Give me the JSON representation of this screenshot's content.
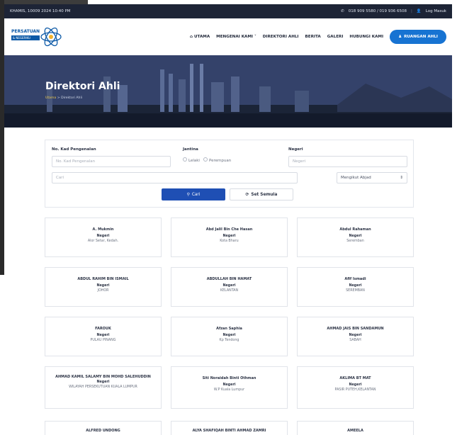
{
  "topbar": {
    "datetime": "KHAMIS, 10009 2024 10:40 PM",
    "phone": "018 909 5580 / 019 936 6508",
    "login": "Log Masuk"
  },
  "header": {
    "logo_line1": "PERSATUAN",
    "logo_line2": "& NEGERIKU",
    "nav": [
      "UTAMA",
      "MENGENAI KAMI",
      "DIREKTORI AHLI",
      "BERITA",
      "GALERI",
      "HUBUNGI KAMI"
    ],
    "cta": "RUANGAN AHLI"
  },
  "hero": {
    "title": "Direktori Ahli",
    "crumb_home": "Utama",
    "crumb_sep": ">",
    "crumb_current": "Direktori Ahli"
  },
  "filter": {
    "ic_label": "No. Kad Pengenalan",
    "ic_placeholder": "No. Kad Pengenalan",
    "gender_label": "Jantina",
    "gender_options": [
      "Lelaki",
      "Perempuan"
    ],
    "state_label": "Negeri",
    "state_placeholder": "Negeri",
    "search_placeholder": "Cari",
    "sort_value": "Mengikut Abjad",
    "search_button": "Cari",
    "reset_button": "Set Semula"
  },
  "members": [
    {
      "name": "A. Mukmin",
      "label": "Negeri",
      "state": "Alor Setar, Kedah."
    },
    {
      "name": "Abd Jalil Bin Che Hasan",
      "label": "Negeri",
      "state": "Kota Bharu"
    },
    {
      "name": "Abdul Rahaman",
      "label": "Negeri",
      "state": "Seremban"
    },
    {
      "name": "ABDUL RAHIM BIN ISMAIL",
      "label": "Negeri",
      "state": "JOHOR"
    },
    {
      "name": "ABDULLAH BIN HAMAT",
      "label": "Negeri",
      "state": "KELANTAN"
    },
    {
      "name": "Afif Ismadi",
      "label": "Negeri",
      "state": "SEREMBAN"
    },
    {
      "name": "FAROUK",
      "label": "Negeri",
      "state": "PULAU PINANG"
    },
    {
      "name": "Afzan Saphia",
      "label": "Negeri",
      "state": "Kp Tendong"
    },
    {
      "name": "AHMAD JAIS BIN SANDAMUN",
      "label": "Negeri",
      "state": "SABAH"
    },
    {
      "name": "AHMAD KAMIL SALAMY BIN MOHD SALEHUDDIN",
      "label": "Negeri",
      "state": "WILAYAH PERSEKUTUAN KUALA LUMPUR"
    },
    {
      "name": "Siti Noraidah Binti Othman",
      "label": "Negeri",
      "state": "W.P Kuala Lumpur"
    },
    {
      "name": "AKLIMA BT MAT",
      "label": "Negeri",
      "state": "PASIR PUTEH,KELANTAN"
    },
    {
      "name": "ALFRED UNDONG",
      "label": "",
      "state": ""
    },
    {
      "name": "ALYA SHAFIQAH BINTI AHMAD ZAMRI",
      "label": "",
      "state": ""
    },
    {
      "name": "AMEELA",
      "label": "",
      "state": ""
    }
  ],
  "colors": {
    "topbar": "#1d2436",
    "accent": "#1773d2",
    "search_button": "#1f4fb4"
  }
}
